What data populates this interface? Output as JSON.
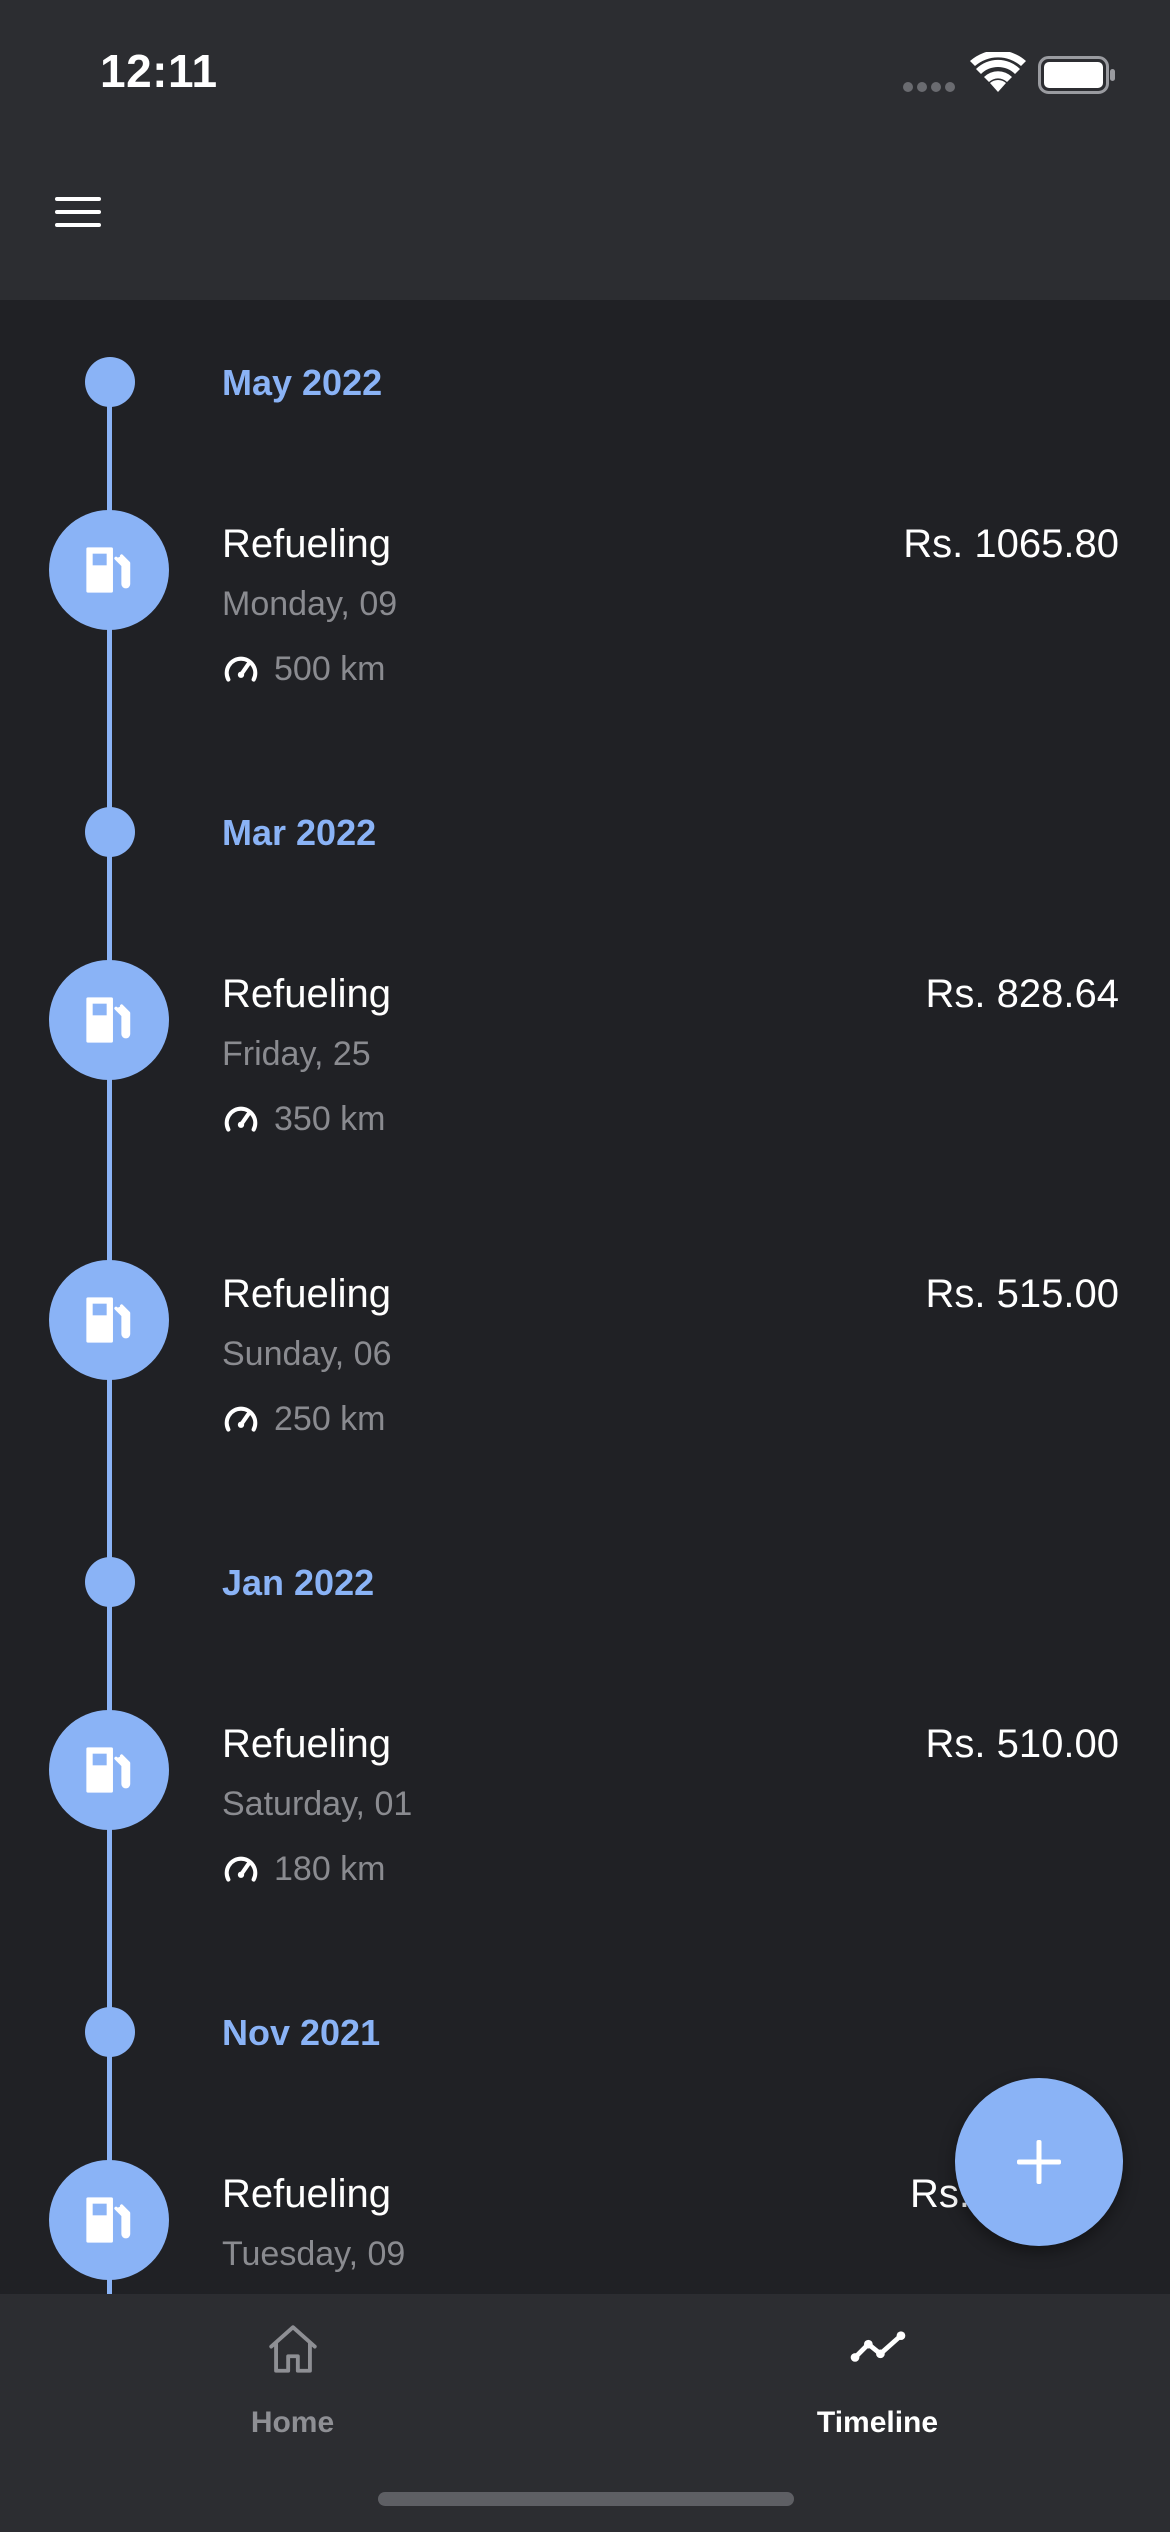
{
  "status_bar": {
    "time": "12:11"
  },
  "colors": {
    "accent": "#8ab3f6",
    "background": "#202125",
    "surface": "#2c2d31",
    "muted_text": "#8a8b90",
    "nav_inactive": "#8e8f94"
  },
  "header": {
    "menu_icon": "hamburger-menu-icon"
  },
  "timeline": {
    "months": [
      {
        "label": "May 2022"
      },
      {
        "label": "Mar 2022"
      },
      {
        "label": "Jan 2022"
      },
      {
        "label": "Nov 2021"
      }
    ],
    "entries": [
      {
        "title": "Refueling",
        "amount": "Rs. 1065.80",
        "date": "Monday, 09",
        "odometer": "500 km",
        "icon": "fuel-pump-icon"
      },
      {
        "title": "Refueling",
        "amount": "Rs. 828.64",
        "date": "Friday, 25",
        "odometer": "350 km",
        "icon": "fuel-pump-icon"
      },
      {
        "title": "Refueling",
        "amount": "Rs. 515.00",
        "date": "Sunday, 06",
        "odometer": "250 km",
        "icon": "fuel-pump-icon"
      },
      {
        "title": "Refueling",
        "amount": "Rs. 510.00",
        "date": "Saturday, 01",
        "odometer": "180 km",
        "icon": "fuel-pump-icon"
      },
      {
        "title": "Refueling",
        "amount": "Rs. ",
        "date": "Tuesday, 09",
        "icon": "fuel-pump-icon"
      }
    ]
  },
  "fab": {
    "icon": "plus-icon"
  },
  "bottom_nav": {
    "items": [
      {
        "label": "Home",
        "icon": "home-icon",
        "active": false
      },
      {
        "label": "Timeline",
        "icon": "timeline-chart-icon",
        "active": true
      }
    ]
  }
}
